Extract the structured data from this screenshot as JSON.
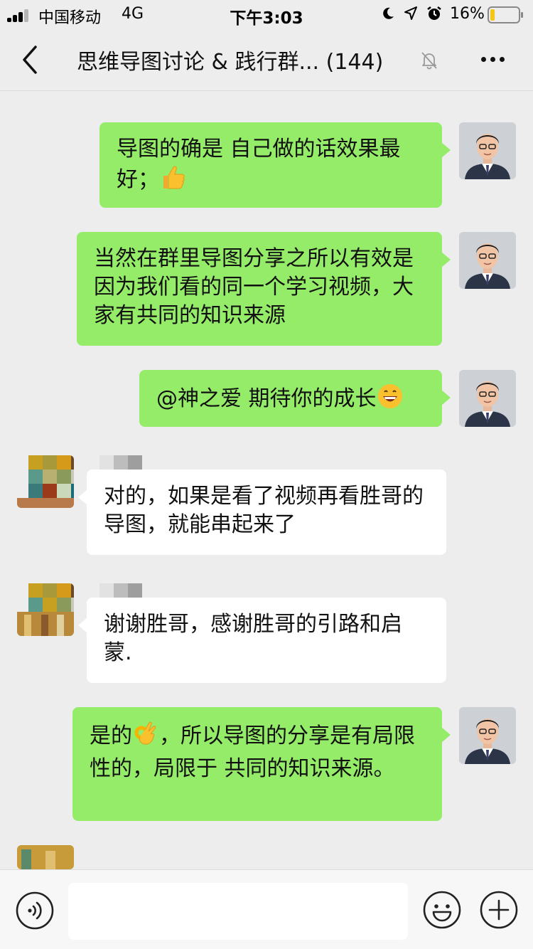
{
  "status_bar": {
    "carrier": "中国移动",
    "network": "4G",
    "time": "下午3:03",
    "battery_percent": "16%",
    "battery_level": 0.16
  },
  "nav": {
    "title": "思维导图讨论 & 践行群... (144)"
  },
  "messages": [
    {
      "direction": "out",
      "text": "导图的确是 自己做的话效果最好；",
      "emoji": "thumbs-up"
    },
    {
      "direction": "out",
      "text": "当然在群里导图分享之所以有效是因为我们看的同一个学习视频，大家有共同的知识来源"
    },
    {
      "direction": "out",
      "text": "@神之爱 期待你的成长",
      "emoji": "grinning-face"
    },
    {
      "direction": "in",
      "text": "对的，如果是看了视频再看胜哥的导图，就能串起来了"
    },
    {
      "direction": "in",
      "text": "谢谢胜哥，感谢胜哥的引路和启蒙."
    },
    {
      "direction": "out",
      "text_before_emoji": "是的",
      "emoji": "ok-hand",
      "text_after_emoji": "，所以导图的分享是有局限性的，局限于 共同的知识来源。"
    }
  ],
  "input": {
    "value": "",
    "placeholder": ""
  },
  "colors": {
    "background": "#ededed",
    "outgoing_bubble": "#95ec69",
    "incoming_bubble": "#ffffff",
    "battery_fill": "#f5c518"
  }
}
